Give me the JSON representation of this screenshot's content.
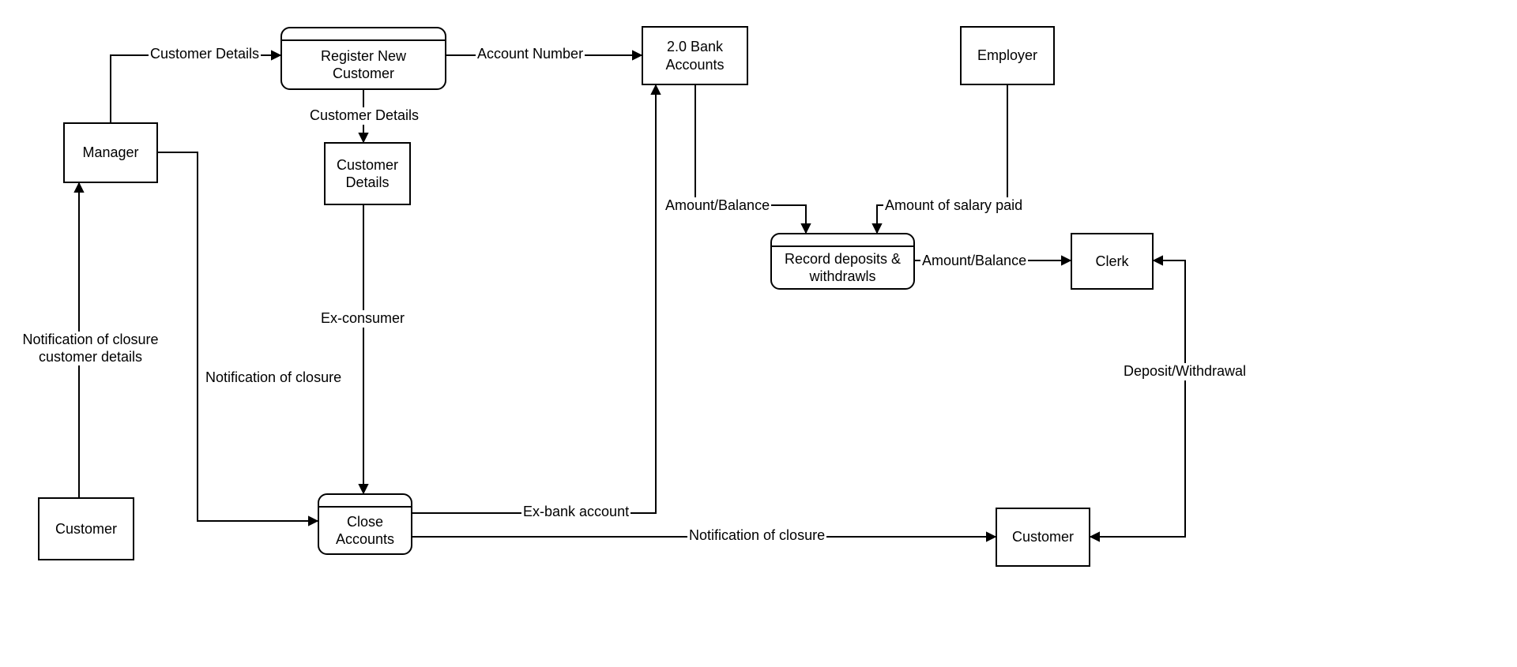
{
  "nodes": {
    "manager": {
      "label": "Manager"
    },
    "customer_bl": {
      "label": "Customer"
    },
    "register": {
      "label": "Register New\nCustomer"
    },
    "cust_details": {
      "label": "Customer\nDetails"
    },
    "close_accts": {
      "label": "Close\nAccounts"
    },
    "bank_accts": {
      "label": "2.0 Bank\nAccounts"
    },
    "employer": {
      "label": "Employer"
    },
    "record": {
      "label": "Record deposits &\nwithdrawls"
    },
    "clerk": {
      "label": "Clerk"
    },
    "customer_br": {
      "label": "Customer"
    }
  },
  "edges": {
    "mgr_to_reg": {
      "label": "Customer Details"
    },
    "reg_to_bank": {
      "label": "Account Number"
    },
    "reg_to_cd": {
      "label": "Customer Details"
    },
    "cd_to_close": {
      "label": "Ex-consumer"
    },
    "mgr_to_close": {
      "label": "Notification of closure"
    },
    "cust_to_mgr": {
      "label": "Notification of closure\ncustomer details"
    },
    "close_to_bank": {
      "label": "Ex-bank account"
    },
    "close_to_custbr": {
      "label": "Notification of closure"
    },
    "bank_to_record": {
      "label": "Amount/Balance"
    },
    "emp_to_record": {
      "label": "Amount of salary paid"
    },
    "record_to_clerk": {
      "label": "Amount/Balance"
    },
    "clerk_custbr": {
      "label": "Deposit/Withdrawal"
    }
  }
}
